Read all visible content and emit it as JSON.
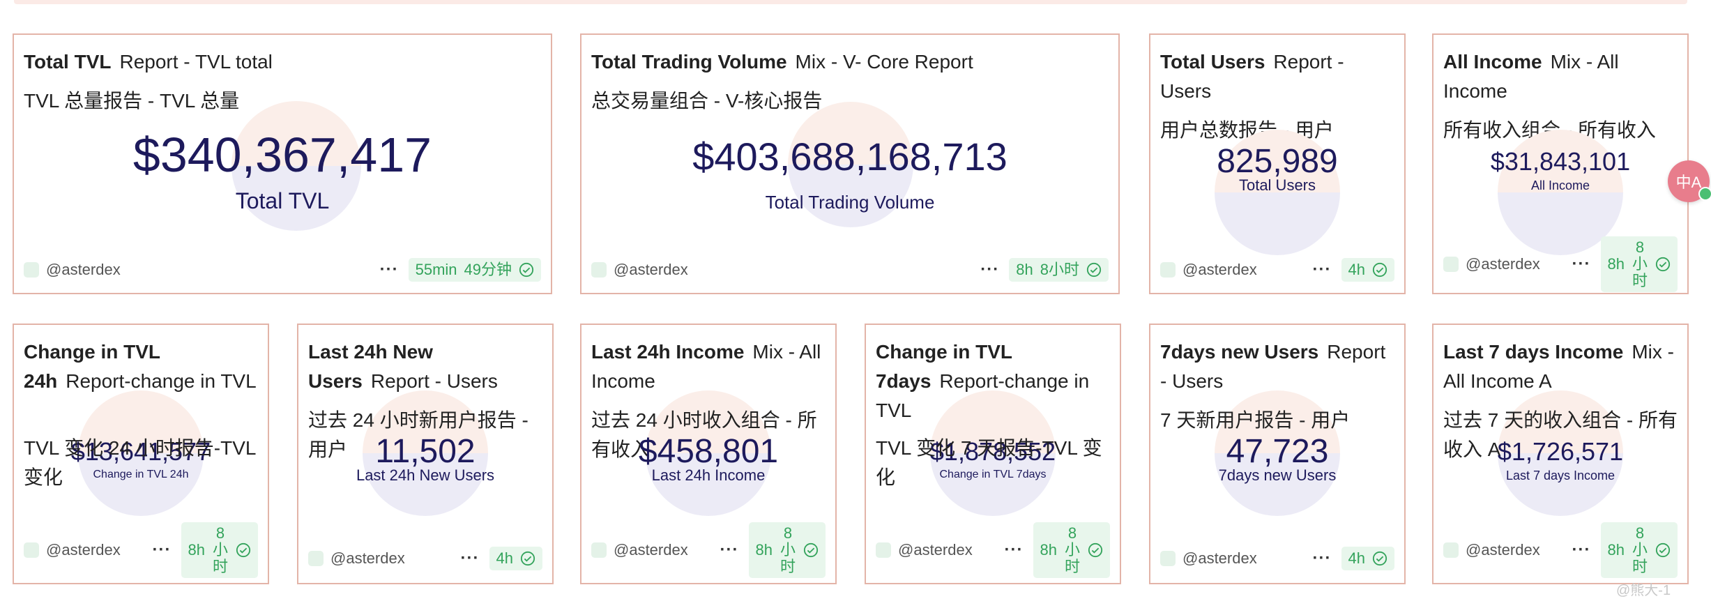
{
  "cards": [
    {
      "title": "Total TVL",
      "subtitle": "Report - TVL total",
      "desc": "TVL 总量报告 - TVL 总量",
      "value": "$340,367,417",
      "label": "Total TVL",
      "author": "@asterdex",
      "badge_main": "55min",
      "badge_alt": "49分钟"
    },
    {
      "title": "Total Trading Volume",
      "subtitle": "Mix - V- Core Report",
      "desc": "总交易量组合 - V-核心报告",
      "value": "$403,688,168,713",
      "label": "Total Trading Volume",
      "author": "@asterdex",
      "badge_main": "8h",
      "badge_alt": "8小时"
    },
    {
      "title": "Total Users",
      "subtitle": "Report - Users",
      "desc": "用户总数报告 - 用户",
      "value": "825,989",
      "label": "Total Users",
      "author": "@asterdex",
      "badge_main": "4h",
      "badge_alt": ""
    },
    {
      "title": "All Income",
      "subtitle": "Mix - All Income",
      "desc": "所有收入组合 - 所有收入",
      "value": "$31,843,101",
      "label": "All Income",
      "author": "@asterdex",
      "badge_main": "8h",
      "badge_alt": "8小时"
    },
    {
      "title": "Change in TVL 24h",
      "subtitle": "Report-change in TVL",
      "desc": "TVL 变化 24 小时报告-TVL 变化",
      "value": "$13,641,577",
      "label": "Change in TVL 24h",
      "author": "@asterdex",
      "badge_main": "8h",
      "badge_alt": "8小时"
    },
    {
      "title": "Last 24h New Users",
      "subtitle": "Report - Users",
      "desc": "过去 24 小时新用户报告 - 用户",
      "value": "11,502",
      "label": "Last 24h New Users",
      "author": "@asterdex",
      "badge_main": "4h",
      "badge_alt": ""
    },
    {
      "title": "Last 24h Income",
      "subtitle": "Mix - All Income",
      "desc": "过去 24 小时收入组合 - 所有收入",
      "value": "$458,801",
      "label": "Last 24h Income",
      "author": "@asterdex",
      "badge_main": "8h",
      "badge_alt": "8小时"
    },
    {
      "title": "Change in TVL 7days",
      "subtitle": "Report-change in TVL",
      "desc": "TVL 变化 7 天报告-TVL 变化",
      "value": "$1,878,552",
      "label": "Change in TVL 7days",
      "author": "@asterdex",
      "badge_main": "8h",
      "badge_alt": "8小时"
    },
    {
      "title": "7days new Users",
      "subtitle": "Report - Users",
      "desc": "7 天新用户报告 - 用户",
      "value": "47,723",
      "label": "7days new Users",
      "author": "@asterdex",
      "badge_main": "4h",
      "badge_alt": ""
    },
    {
      "title": "Last 7 days Income",
      "subtitle": "Mix - All Income A",
      "desc": "过去 7 天的收入组合 - 所有收入 A",
      "value": "$1,726,571",
      "label": "Last 7 days Income",
      "author": "@asterdex",
      "badge_main": "8h",
      "badge_alt": "8小时"
    }
  ],
  "icons": {
    "more": "more-dots-icon",
    "check": "check-circle-icon",
    "avatar": "avatar-icon",
    "translate": "translate-icon"
  },
  "colors": {
    "border": "#e3b4a8",
    "metric": "#1d1a5c",
    "badge_bg": "#e8f6ec",
    "badge_text": "#33a35b"
  },
  "overlay": {
    "translate_glyph": "中A",
    "watermark": "@熊大-1"
  }
}
